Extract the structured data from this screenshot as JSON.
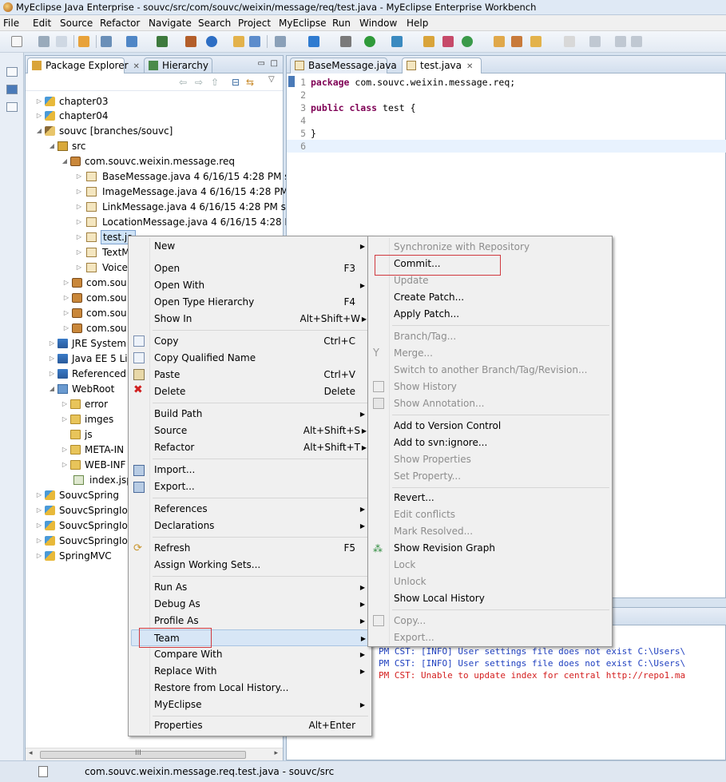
{
  "window_title": "MyEclipse Java Enterprise - souvc/src/com/souvc/weixin/message/req/test.java - MyEclipse Enterprise Workbench",
  "menubar": [
    "File",
    "Edit",
    "Source",
    "Refactor",
    "Navigate",
    "Search",
    "Project",
    "MyEclipse",
    "Run",
    "Window",
    "Help"
  ],
  "package_explorer": {
    "tab_label": "Package Explorer",
    "tab2_label": "Hierarchy",
    "tree": [
      {
        "label": "chapter03"
      },
      {
        "label": "chapter04"
      },
      {
        "label": "souvc [branches/souvc]"
      },
      {
        "label": "src"
      },
      {
        "label": "com.souvc.weixin.message.req"
      },
      {
        "label": "BaseMessage.java 4  6/16/15 4:28 PM  s"
      },
      {
        "label": "ImageMessage.java 4  6/16/15 4:28 PM"
      },
      {
        "label": "LinkMessage.java 4  6/16/15 4:28 PM  sc"
      },
      {
        "label": "LocationMessage.java 4  6/16/15 4:28 PM"
      },
      {
        "label": "test.ja"
      },
      {
        "label": "TextM"
      },
      {
        "label": "Voice"
      },
      {
        "label": "com.sou"
      },
      {
        "label": "com.sou"
      },
      {
        "label": "com.sou"
      },
      {
        "label": "com.sou"
      },
      {
        "label": "JRE System"
      },
      {
        "label": "Java EE 5 Li"
      },
      {
        "label": "Referenced"
      },
      {
        "label": "WebRoot"
      },
      {
        "label": "error"
      },
      {
        "label": "imges"
      },
      {
        "label": "js"
      },
      {
        "label": "META-IN"
      },
      {
        "label": "WEB-INF"
      },
      {
        "label": "index.jsp"
      },
      {
        "label": "SouvcSpring"
      },
      {
        "label": "SouvcSpringIoC"
      },
      {
        "label": "SouvcSpringIoC"
      },
      {
        "label": "SouvcSpringIoC"
      },
      {
        "label": "SpringMVC"
      }
    ],
    "hscroll_label": "III"
  },
  "editor": {
    "tabs": [
      {
        "label": "BaseMessage.java"
      },
      {
        "label": "test.java"
      }
    ],
    "code": [
      {
        "num": "1",
        "kw": "package",
        "rest": " com.souvc.weixin.message.req;"
      },
      {
        "num": "2",
        "kw": "",
        "rest": ""
      },
      {
        "num": "3",
        "kw": "public class",
        "rest": " test {"
      },
      {
        "num": "4",
        "kw": "",
        "rest": ""
      },
      {
        "num": "5",
        "kw": "",
        "rest": "}"
      },
      {
        "num": "6",
        "kw": "",
        "rest": ""
      }
    ]
  },
  "console": {
    "lines": [
      {
        "text": "PM CST: [INFO] User settings file does not exist C:\\Users\\"
      },
      {
        "text": "PM CST: [INFO] User settings file does not exist C:\\Users\\"
      },
      {
        "text": "PM CST: Unable to update index for central http://repo1.ma"
      }
    ],
    "info_color": "#1e3fbf",
    "error_color": "#d42020"
  },
  "context_menu": {
    "items": [
      {
        "label": "New",
        "shortcut": "",
        "submenu": true
      },
      {
        "label": "Open",
        "shortcut": "F3",
        "submenu": false
      },
      {
        "label": "Open With",
        "shortcut": "",
        "submenu": true
      },
      {
        "label": "Open Type Hierarchy",
        "shortcut": "F4",
        "submenu": false
      },
      {
        "label": "Show In",
        "shortcut": "Alt+Shift+W",
        "submenu": true
      },
      {
        "label": "Copy",
        "shortcut": "Ctrl+C",
        "submenu": false
      },
      {
        "label": "Copy Qualified Name",
        "shortcut": "",
        "submenu": false
      },
      {
        "label": "Paste",
        "shortcut": "Ctrl+V",
        "submenu": false
      },
      {
        "label": "Delete",
        "shortcut": "Delete",
        "submenu": false
      },
      {
        "label": "Build Path",
        "shortcut": "",
        "submenu": true
      },
      {
        "label": "Source",
        "shortcut": "Alt+Shift+S",
        "submenu": true
      },
      {
        "label": "Refactor",
        "shortcut": "Alt+Shift+T",
        "submenu": true
      },
      {
        "label": "Import...",
        "shortcut": "",
        "submenu": false
      },
      {
        "label": "Export...",
        "shortcut": "",
        "submenu": false
      },
      {
        "label": "References",
        "shortcut": "",
        "submenu": true
      },
      {
        "label": "Declarations",
        "shortcut": "",
        "submenu": true
      },
      {
        "label": "Refresh",
        "shortcut": "F5",
        "submenu": false
      },
      {
        "label": "Assign Working Sets...",
        "shortcut": "",
        "submenu": false
      },
      {
        "label": "Run As",
        "shortcut": "",
        "submenu": true
      },
      {
        "label": "Debug As",
        "shortcut": "",
        "submenu": true
      },
      {
        "label": "Profile As",
        "shortcut": "",
        "submenu": true
      },
      {
        "label": "Team",
        "shortcut": "",
        "submenu": true
      },
      {
        "label": "Compare With",
        "shortcut": "",
        "submenu": true
      },
      {
        "label": "Replace With",
        "shortcut": "",
        "submenu": true
      },
      {
        "label": "Restore from Local History...",
        "shortcut": "",
        "submenu": false
      },
      {
        "label": "MyEclipse",
        "shortcut": "",
        "submenu": true
      },
      {
        "label": "Properties",
        "shortcut": "Alt+Enter",
        "submenu": false
      }
    ]
  },
  "team_submenu": {
    "items": [
      {
        "label": "Synchronize with Repository",
        "enabled": false
      },
      {
        "label": "Commit...",
        "enabled": true
      },
      {
        "label": "Update",
        "enabled": false
      },
      {
        "label": "Create Patch...",
        "enabled": true
      },
      {
        "label": "Apply Patch...",
        "enabled": true
      },
      {
        "label": "Branch/Tag...",
        "enabled": false
      },
      {
        "label": "Merge...",
        "enabled": false
      },
      {
        "label": "Switch to another Branch/Tag/Revision...",
        "enabled": false
      },
      {
        "label": "Show History",
        "enabled": false
      },
      {
        "label": "Show Annotation...",
        "enabled": false
      },
      {
        "label": "Add to Version Control",
        "enabled": true
      },
      {
        "label": "Add to svn:ignore...",
        "enabled": true
      },
      {
        "label": "Show Properties",
        "enabled": false
      },
      {
        "label": "Set Property...",
        "enabled": false
      },
      {
        "label": "Revert...",
        "enabled": true
      },
      {
        "label": "Edit conflicts",
        "enabled": false
      },
      {
        "label": "Mark Resolved...",
        "enabled": false
      },
      {
        "label": "Show Revision Graph",
        "enabled": true
      },
      {
        "label": "Lock",
        "enabled": false
      },
      {
        "label": "Unlock",
        "enabled": false
      },
      {
        "label": "Show Local History",
        "enabled": true
      },
      {
        "label": "Copy...",
        "enabled": false
      },
      {
        "label": "Export...",
        "enabled": false
      }
    ]
  },
  "status_text": "com.souvc.weixin.message.req.test.java - souvc/src",
  "colors": {
    "highlight_box": "#d0393f",
    "keyword": "#7f0055",
    "selection": "#cfe3f7"
  }
}
